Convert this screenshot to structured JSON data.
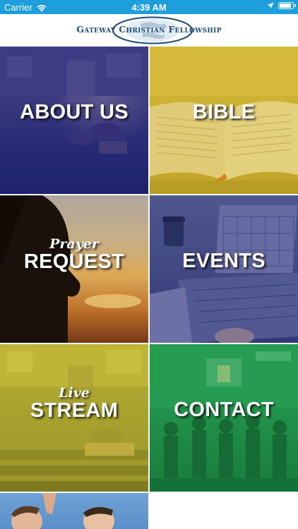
{
  "status_bar": {
    "carrier": "Carrier",
    "time": "4:39 AM",
    "battery_level": 0.95,
    "background_color": "#1e9fdc",
    "icons": [
      "wifi-icon",
      "location-arrow-icon",
      "battery-icon"
    ]
  },
  "header": {
    "logo_text": "Gateway Christian Fellowship",
    "logo_icon": "globe-logo-icon",
    "text_color": "#1b4c7a"
  },
  "tiles": [
    {
      "id": "about",
      "label": "ABOUT US",
      "script": "",
      "tint": "#2d2d8c"
    },
    {
      "id": "bible",
      "label": "BIBLE",
      "script": "",
      "tint": "#d4b428"
    },
    {
      "id": "prayer",
      "label": "REQUEST",
      "script": "Prayer",
      "tint": "#000000"
    },
    {
      "id": "events",
      "label": "EVENTS",
      "script": "",
      "tint": "#283296"
    },
    {
      "id": "live",
      "label": "STREAM",
      "script": "Live",
      "tint": "#beb428"
    },
    {
      "id": "contact",
      "label": "CONTACT",
      "script": "",
      "tint": "#14a046"
    },
    {
      "id": "youth",
      "label": "",
      "script": "",
      "tint": "#5b8fc8"
    }
  ]
}
